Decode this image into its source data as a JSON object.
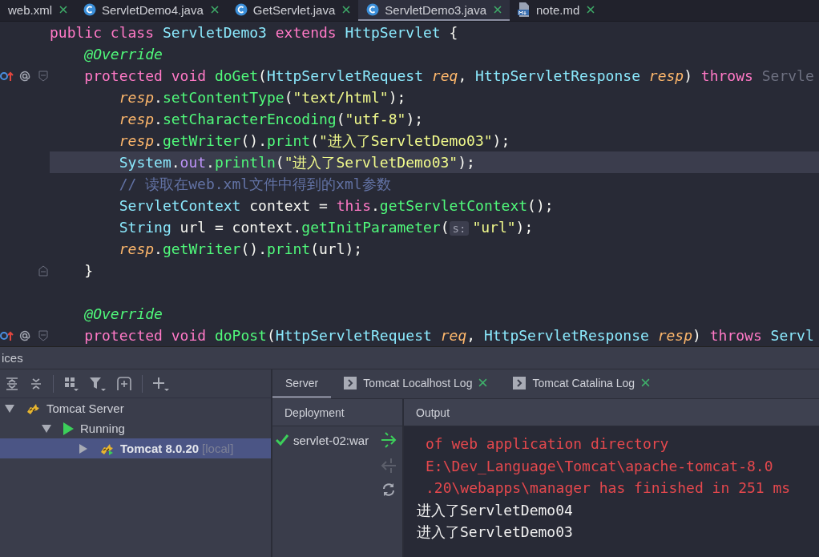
{
  "tabs": [
    {
      "label": "web.xml",
      "selected": false
    },
    {
      "label": "ServletDemo4.java",
      "kind": "class",
      "selected": false
    },
    {
      "label": "GetServlet.java",
      "kind": "class",
      "selected": false
    },
    {
      "label": "ServletDemo3.java",
      "kind": "class",
      "selected": true
    },
    {
      "label": "note.md",
      "kind": "markdown",
      "selected": false
    }
  ],
  "editor": {
    "lines": [
      {
        "kind": "plain",
        "highlighted": false,
        "gutter_icons": false,
        "tokens": [
          {
            "kind": "kw",
            "s": "public class "
          },
          {
            "kind": "type",
            "s": "ServletDemo3 "
          },
          {
            "kind": "kw",
            "s": "extends "
          },
          {
            "kind": "type",
            "s": "HttpServlet "
          },
          {
            "kind": "plain",
            "s": "{"
          }
        ]
      },
      {
        "kind": "plain",
        "highlighted": false,
        "gutter_icons": false,
        "tokens": [
          {
            "kind": "ann",
            "s": "    @Override"
          }
        ]
      },
      {
        "kind": "fold-start",
        "highlighted": false,
        "gutter_icons": true,
        "tokens": [
          {
            "kind": "kw",
            "s": "    protected void "
          },
          {
            "kind": "fn",
            "s": "doGet"
          },
          {
            "kind": "plain",
            "s": "("
          },
          {
            "kind": "type",
            "s": "HttpServletRequest "
          },
          {
            "kind": "param",
            "s": "req"
          },
          {
            "kind": "plain",
            "s": ", "
          },
          {
            "kind": "type",
            "s": "HttpServletResponse "
          },
          {
            "kind": "param",
            "s": "resp"
          },
          {
            "kind": "plain",
            "s": ") "
          },
          {
            "kind": "kw",
            "s": "throws "
          },
          {
            "kind": "dim",
            "s": "Servle"
          }
        ]
      },
      {
        "kind": "plain",
        "highlighted": false,
        "gutter_icons": false,
        "tokens": [
          {
            "kind": "param",
            "s": "        resp"
          },
          {
            "kind": "plain",
            "s": "."
          },
          {
            "kind": "fn",
            "s": "setContentType"
          },
          {
            "kind": "plain",
            "s": "("
          },
          {
            "kind": "str",
            "s": "\"text/html\""
          },
          {
            "kind": "plain",
            "s": ");"
          }
        ]
      },
      {
        "kind": "plain",
        "highlighted": false,
        "gutter_icons": false,
        "tokens": [
          {
            "kind": "param",
            "s": "        resp"
          },
          {
            "kind": "plain",
            "s": "."
          },
          {
            "kind": "fn",
            "s": "setCharacterEncoding"
          },
          {
            "kind": "plain",
            "s": "("
          },
          {
            "kind": "str",
            "s": "\"utf-8\""
          },
          {
            "kind": "plain",
            "s": ");"
          }
        ]
      },
      {
        "kind": "plain",
        "highlighted": false,
        "gutter_icons": false,
        "tokens": [
          {
            "kind": "param",
            "s": "        resp"
          },
          {
            "kind": "plain",
            "s": "."
          },
          {
            "kind": "fn",
            "s": "getWriter"
          },
          {
            "kind": "plain",
            "s": "()."
          },
          {
            "kind": "fn",
            "s": "print"
          },
          {
            "kind": "plain",
            "s": "("
          },
          {
            "kind": "str",
            "s": "\"进入了ServletDemo03\""
          },
          {
            "kind": "plain",
            "s": ");"
          }
        ]
      },
      {
        "kind": "plain",
        "highlighted": true,
        "gutter_icons": false,
        "tokens": [
          {
            "kind": "type",
            "s": "        System"
          },
          {
            "kind": "plain",
            "s": "."
          },
          {
            "kind": "field",
            "s": "out"
          },
          {
            "kind": "plain",
            "s": "."
          },
          {
            "kind": "fn",
            "s": "println"
          },
          {
            "kind": "plain",
            "s": "("
          },
          {
            "kind": "str",
            "s": "\"进入了ServletDemo03\""
          },
          {
            "kind": "plain",
            "s": ");"
          }
        ]
      },
      {
        "kind": "plain",
        "highlighted": false,
        "gutter_icons": false,
        "tokens": [
          {
            "kind": "comment",
            "s": "        // 读取在web.xml文件中得到的xml参数"
          }
        ]
      },
      {
        "kind": "plain",
        "highlighted": false,
        "gutter_icons": false,
        "tokens": [
          {
            "kind": "type",
            "s": "        ServletContext "
          },
          {
            "kind": "plain",
            "s": "context = "
          },
          {
            "kind": "kw",
            "s": "this"
          },
          {
            "kind": "plain",
            "s": "."
          },
          {
            "kind": "fn",
            "s": "getServletContext"
          },
          {
            "kind": "plain",
            "s": "();"
          }
        ]
      },
      {
        "kind": "plain",
        "highlighted": false,
        "gutter_icons": false,
        "tokens": [
          {
            "kind": "type",
            "s": "        String "
          },
          {
            "kind": "plain",
            "s": "url = context."
          },
          {
            "kind": "fn",
            "s": "getInitParameter"
          },
          {
            "kind": "plain",
            "s": "("
          },
          {
            "kind": "hint",
            "s": "s:"
          },
          {
            "kind": "str",
            "s": "\"url\""
          },
          {
            "kind": "plain",
            "s": ");"
          }
        ]
      },
      {
        "kind": "plain",
        "highlighted": false,
        "gutter_icons": false,
        "tokens": [
          {
            "kind": "param",
            "s": "        resp"
          },
          {
            "kind": "plain",
            "s": "."
          },
          {
            "kind": "fn",
            "s": "getWriter"
          },
          {
            "kind": "plain",
            "s": "()."
          },
          {
            "kind": "fn",
            "s": "print"
          },
          {
            "kind": "plain",
            "s": "(url);"
          }
        ]
      },
      {
        "kind": "fold-end",
        "highlighted": false,
        "gutter_icons": false,
        "tokens": [
          {
            "kind": "plain",
            "s": "    }"
          }
        ]
      },
      {
        "kind": "plain",
        "highlighted": false,
        "gutter_icons": false
      },
      {
        "kind": "plain",
        "highlighted": false,
        "gutter_icons": false,
        "tokens": [
          {
            "kind": "ann",
            "s": "    @Override"
          }
        ]
      },
      {
        "kind": "fold-start",
        "highlighted": false,
        "gutter_icons": true,
        "tokens": [
          {
            "kind": "kw",
            "s": "    protected void "
          },
          {
            "kind": "fn",
            "s": "doPost"
          },
          {
            "kind": "plain",
            "s": "("
          },
          {
            "kind": "type",
            "s": "HttpServletRequest "
          },
          {
            "kind": "param",
            "s": "req"
          },
          {
            "kind": "plain",
            "s": ", "
          },
          {
            "kind": "type",
            "s": "HttpServletResponse "
          },
          {
            "kind": "param",
            "s": "resp"
          },
          {
            "kind": "plain",
            "s": ") "
          },
          {
            "kind": "kw",
            "s": "throws "
          },
          {
            "kind": "type",
            "s": "Servl"
          }
        ]
      }
    ]
  },
  "services": {
    "title": "ices",
    "tree": [
      {
        "label": "Tomcat Server",
        "kind": "tomcat",
        "expanded": true,
        "selected": false,
        "children": [
          {
            "label": "Running",
            "kind": "run",
            "expanded": true,
            "selected": false,
            "children": [
              {
                "label": "Tomcat 8.0.20",
                "suffix": "[local]",
                "kind": "tomcat-run",
                "expanded": false,
                "selected": true
              }
            ]
          }
        ]
      }
    ],
    "tabs": [
      {
        "label": "Server",
        "selected": true,
        "closable": false
      },
      {
        "label": "Tomcat Localhost Log",
        "kind": "console",
        "selected": false,
        "closable": true
      },
      {
        "label": "Tomcat Catalina Log",
        "kind": "console",
        "selected": false,
        "closable": true
      }
    ],
    "deployment": {
      "header": "Deployment",
      "items": [
        {
          "name": "servlet-02:war",
          "kind": "deployed"
        }
      ]
    },
    "output": {
      "header": "Output",
      "lines": [
        {
          "kind": "error",
          "text": "of web application directory"
        },
        {
          "kind": "error",
          "text": "E:\\Dev_Language\\Tomcat\\apache-tomcat-8.0"
        },
        {
          "kind": "error",
          "text": ".20\\webapps\\manager has finished in 251 ms"
        },
        {
          "kind": "info",
          "text": "进入了ServletDemo04"
        },
        {
          "kind": "info",
          "text": "进入了ServletDemo03"
        }
      ]
    }
  }
}
